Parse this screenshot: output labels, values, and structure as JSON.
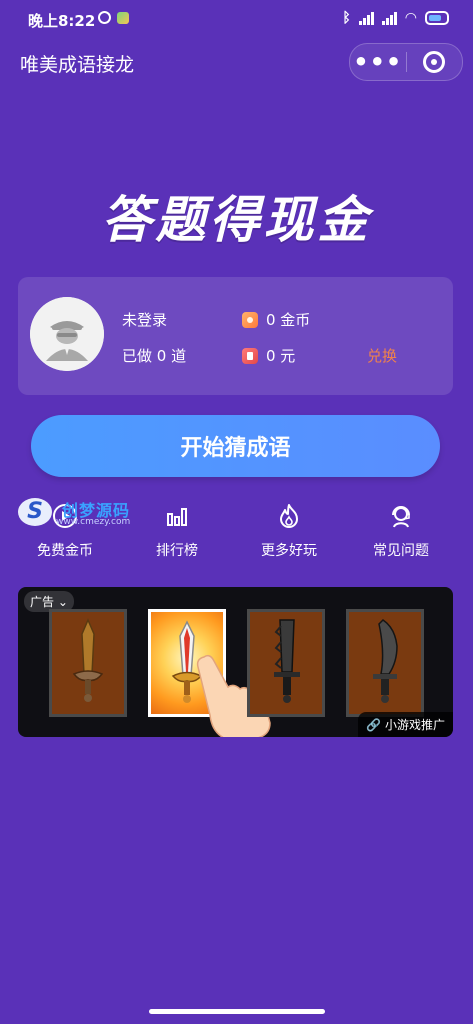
{
  "status_bar": {
    "time": "晚上8:22"
  },
  "header": {
    "title": "唯美成语接龙"
  },
  "banner": {
    "title": "答题得现金"
  },
  "user": {
    "login_status": "未登录",
    "done_label": "已做 0 道",
    "coins": "0 金币",
    "cash": "0 元",
    "exchange_label": "兑换"
  },
  "start_button": {
    "label": "开始猜成语"
  },
  "watermark": {
    "text": "创梦源码",
    "url": "www.cmezy.com"
  },
  "quick_menu": [
    {
      "label": "免费金币",
      "icon": "play-icon"
    },
    {
      "label": "排行榜",
      "icon": "bar-chart-icon"
    },
    {
      "label": "更多好玩",
      "icon": "fire-icon"
    },
    {
      "label": "常见问题",
      "icon": "support-icon"
    }
  ],
  "ad": {
    "tag": "广告",
    "promo_label": "小游戏推广"
  },
  "colors": {
    "background": "#5a31b8",
    "button": "#5a8dff",
    "exchange": "#f0824b"
  }
}
